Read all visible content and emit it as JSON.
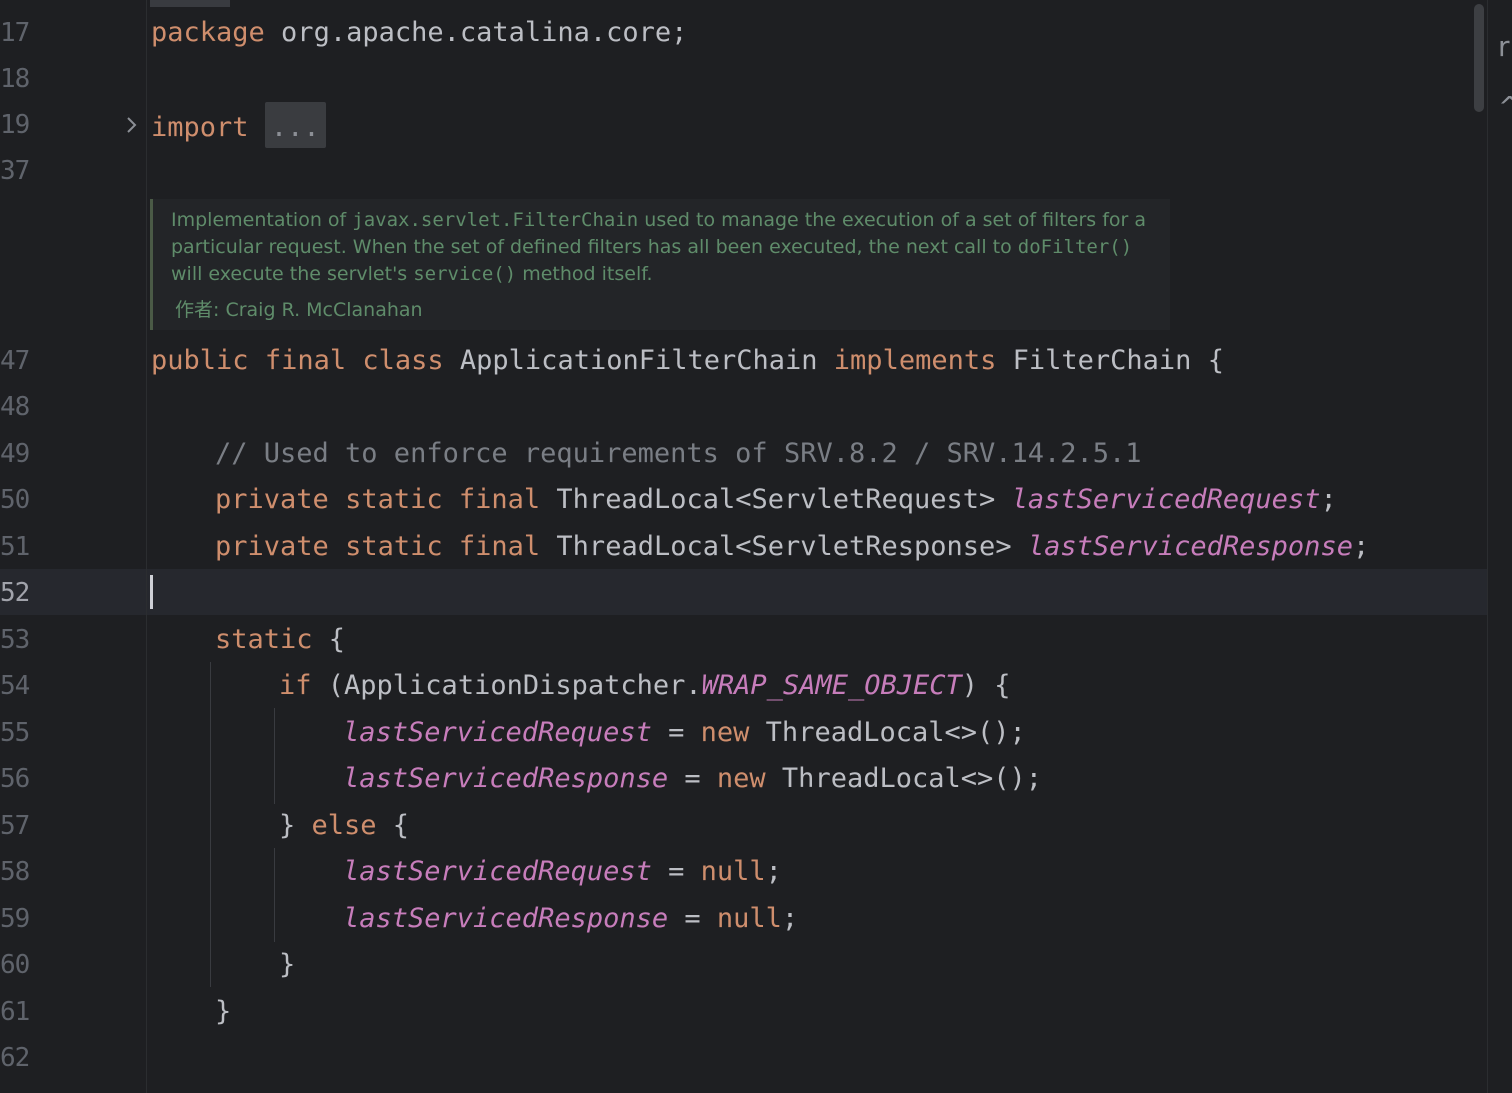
{
  "editor": {
    "line_numbers": [
      "17",
      "18",
      "19",
      "37",
      "47",
      "48",
      "49",
      "50",
      "51",
      "52",
      "53",
      "54",
      "55",
      "56",
      "57",
      "58",
      "59",
      "60",
      "61",
      "62"
    ],
    "current_line": "52",
    "code": {
      "line17": {
        "kw": "package",
        "rest": " org.apache.catalina.core;"
      },
      "line19": {
        "kw": "import",
        "folded": "..."
      },
      "line47": {
        "kw1": "public",
        "kw2": "final",
        "kw3": "class",
        "name": "ApplicationFilterChain",
        "kw4": "implements",
        "iface": "FilterChain {"
      },
      "line49": {
        "comment": "// Used to enforce requirements of SRV.8.2 / SRV.14.2.5.1"
      },
      "line50": {
        "kw1": "private",
        "kw2": "static",
        "kw3": "final",
        "type": "ThreadLocal<ServletRequest>",
        "field": "lastServicedRequest",
        "end": ";"
      },
      "line51": {
        "kw1": "private",
        "kw2": "static",
        "kw3": "final",
        "type": "ThreadLocal<ServletResponse>",
        "field": "lastServicedResponse",
        "end": ";"
      },
      "line53": {
        "kw": "static",
        "rest": " {"
      },
      "line54": {
        "kw": "if",
        "pre": " (ApplicationDispatcher.",
        "const": "WRAP_SAME_OBJECT",
        "post": ") {"
      },
      "line55": {
        "field": "lastServicedRequest",
        "op": " = ",
        "kw": "new",
        "rest": " ThreadLocal<>();"
      },
      "line56": {
        "field": "lastServicedResponse",
        "op": " = ",
        "kw": "new",
        "rest": " ThreadLocal<>();"
      },
      "line57": {
        "pre": "} ",
        "kw": "else",
        "post": " {"
      },
      "line58": {
        "field": "lastServicedRequest",
        "op": " = ",
        "kw": "null",
        "end": ";"
      },
      "line59": {
        "field": "lastServicedResponse",
        "op": " = ",
        "kw": "null",
        "end": ";"
      },
      "line60": {
        "text": "}"
      },
      "line61": {
        "text": "}"
      }
    },
    "javadoc": {
      "p1": "Implementation of ",
      "c1": "javax.servlet.FilterChain",
      "p2": " used to manage the execution of a set of filters for a particular request. When the set of defined filters has all been executed, the next call to ",
      "c2": "doFilter()",
      "p3": " will execute the servlet's ",
      "c3": "service()",
      "p4": " method itself.",
      "author_label": "作者:",
      "author_name": "Craig R. McClanahan"
    },
    "right_glyphs": [
      "r",
      "^"
    ]
  },
  "colors": {
    "background": "#1e1f22",
    "keyword": "#cf8e6d",
    "field": "#c77dbb",
    "comment": "#7a7e85",
    "text": "#bcbec4",
    "doc": "#5f8c6a",
    "current_line_bg": "#26282e"
  },
  "icons": {
    "fold": "chevron-right-icon"
  }
}
